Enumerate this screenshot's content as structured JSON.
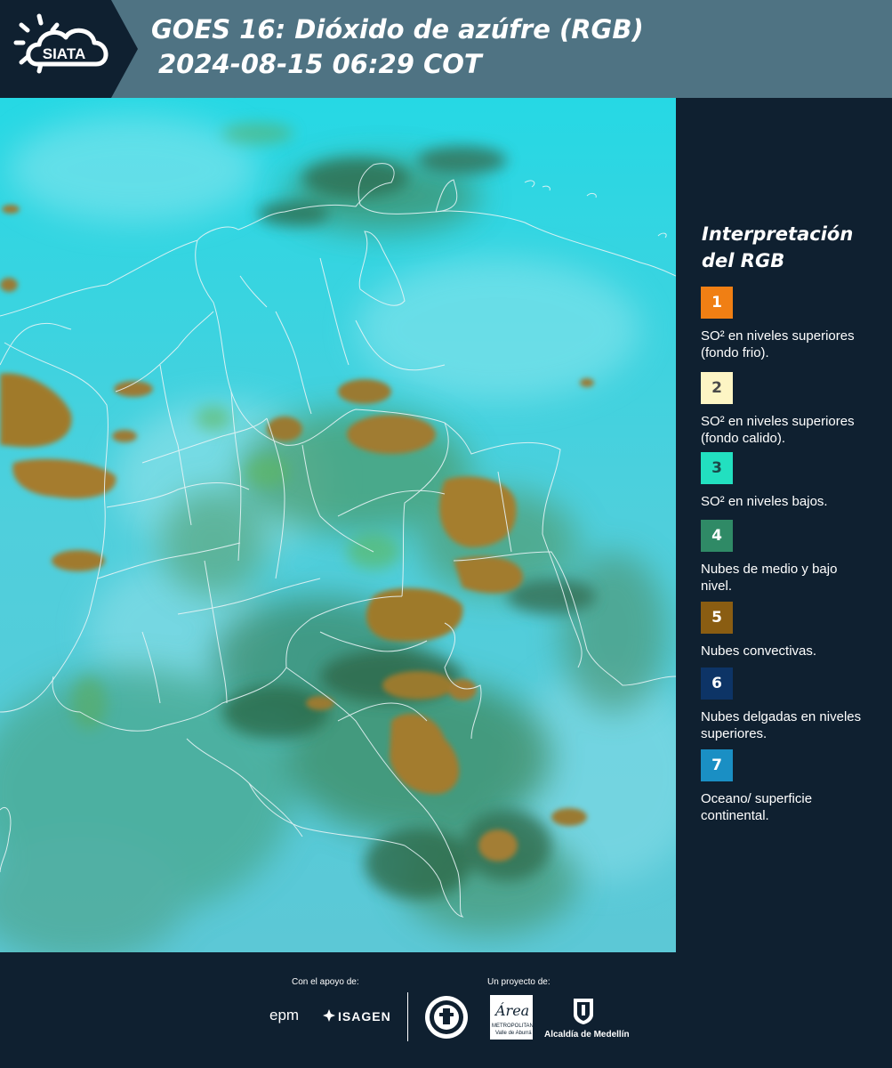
{
  "header": {
    "brand": "SIATA",
    "title_line1": "GOES 16: Dióxido de azúfre (RGB)",
    "title_line2": "2024-08-15 06:29 COT"
  },
  "legend": {
    "title": "Interpretación del RGB",
    "items": [
      {
        "number": "1",
        "text": "SO² en niveles superiores (fondo frio).",
        "color": "#f07f14",
        "text_color": "#ffffff"
      },
      {
        "number": "2",
        "text": "SO² en niveles superiores (fondo calido).",
        "color": "#fdf5c4",
        "text_color": "#4a4a4a"
      },
      {
        "number": "3",
        "text": "SO² en niveles bajos.",
        "color": "#22e0c0",
        "text_color": "#1a4a4a"
      },
      {
        "number": "4",
        "text": "Nubes de medio y bajo nivel.",
        "color": "#2f8a66",
        "text_color": "#ffffff"
      },
      {
        "number": "5",
        "text": "Nubes convectivas.",
        "color": "#8a5d12",
        "text_color": "#ffffff"
      },
      {
        "number": "6",
        "text": "Nubes delgadas en niveles superiores.",
        "color": "#0d3466",
        "text_color": "#ffffff"
      },
      {
        "number": "7",
        "text": "Oceano/ superficie continental.",
        "color": "#1a8fc4",
        "text_color": "#ffffff"
      }
    ]
  },
  "footer": {
    "support_label": "Con el apoyo de:",
    "project_label": "Un proyecto de:",
    "epm": "epm",
    "isagen": "ISAGEN",
    "area_word": "Área",
    "area_sub1": "METROPOLITANA",
    "area_sub2": "Valle de Aburrá",
    "alcaldia": "Alcaldía de Medellín"
  },
  "colors": {
    "header_bg": "#4f7383",
    "panel_bg": "#0f2030",
    "map_cyan": "#3fd3e0",
    "cloud_brown": "#9a7a28",
    "cloud_green": "#3f9a5c"
  }
}
